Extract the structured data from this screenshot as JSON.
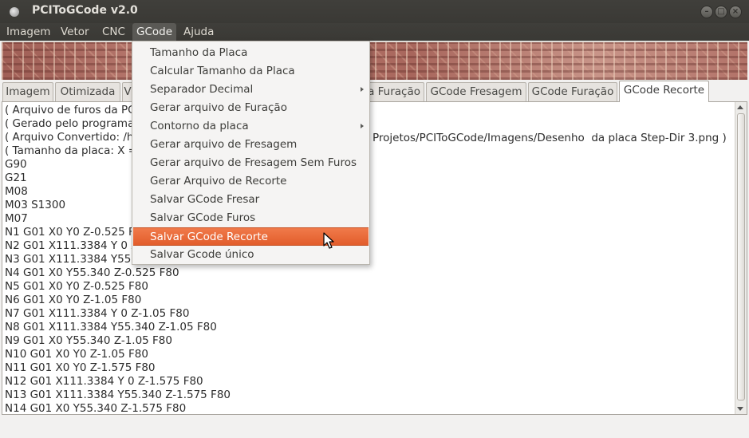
{
  "window": {
    "title": "PCIToGCode  v2.0",
    "buttons": [
      "minimize",
      "maximize",
      "close"
    ]
  },
  "menubar": {
    "items": [
      "Imagem",
      "Vetor",
      "CNC",
      "GCode",
      "Ajuda"
    ],
    "active": "GCode"
  },
  "tabs": {
    "items": [
      "Imagem",
      "Otimizada",
      "V",
      "a Furação",
      "GCode Fresagem",
      "GCode Furação",
      "GCode Recorte"
    ],
    "active": "GCode Recorte"
  },
  "gcode_menu": {
    "items": [
      {
        "label": "Tamanho da Placa",
        "submenu": false
      },
      {
        "label": "Calcular Tamanho da Placa",
        "submenu": false
      },
      {
        "label": "Separador Decimal",
        "submenu": true
      },
      {
        "label": "Gerar arquivo de Furação",
        "submenu": false
      },
      {
        "label": "Contorno da placa",
        "submenu": true
      },
      {
        "label": "Gerar arquivo de Fresagem",
        "submenu": false
      },
      {
        "label": "Gerar arquivo de Fresagem Sem Furos",
        "submenu": false
      },
      {
        "label": "Gerar Arquivo de Recorte",
        "submenu": false
      },
      {
        "label": "Salvar GCode Fresar",
        "submenu": false
      },
      {
        "label": "Salvar GCode Furos",
        "submenu": false
      },
      {
        "label": "Salvar GCode Recorte",
        "submenu": false
      },
      {
        "label": "Salvar Gcode único",
        "submenu": false
      }
    ],
    "highlighted": "Salvar GCode Recorte"
  },
  "code": {
    "lines": [
      "( Arquivo de furos da PC",
      "( Gerado pelo programa",
      "( Arquivo Convertido: /h",
      "( Tamanho da placa: X =",
      "G90",
      "G21",
      "M08",
      "M03 S1300",
      "M07",
      "N1 G01 X0 Y0 Z-0.525 F8",
      "N2 G01 X111.3384 Y 0 Z-",
      "N3 G01 X111.3384 Y55.3",
      "N4 G01 X0 Y55.340 Z-0.525 F80",
      "N5 G01 X0 Y0 Z-0.525 F80",
      "N6 G01 X0 Y0 Z-1.05 F80",
      "N7 G01 X111.3384 Y 0 Z-1.05 F80",
      "N8 G01 X111.3384 Y55.340 Z-1.05 F80",
      "N9 G01 X0 Y55.340 Z-1.05 F80",
      "N10 G01 X0 Y0 Z-1.05 F80",
      "N11 G01 X0 Y0 Z-1.575 F80",
      "N12 G01 X111.3384 Y 0 Z-1.575 F80",
      "N13 G01 X111.3384 Y55.340 Z-1.575 F80",
      "N14 G01 X0 Y55.340 Z-1.575 F80"
    ],
    "path_visible_right": "Projetos/PCIToGCode/Imagens/Desenho  da placa Step-Dir 3.png )"
  },
  "icons": {
    "app": "app-icon",
    "pointer": "mouse-pointer-icon"
  },
  "colors": {
    "titlebar": "#3c3b37",
    "highlight": "#e8673a",
    "menu_bg": "#f5f4f3"
  }
}
